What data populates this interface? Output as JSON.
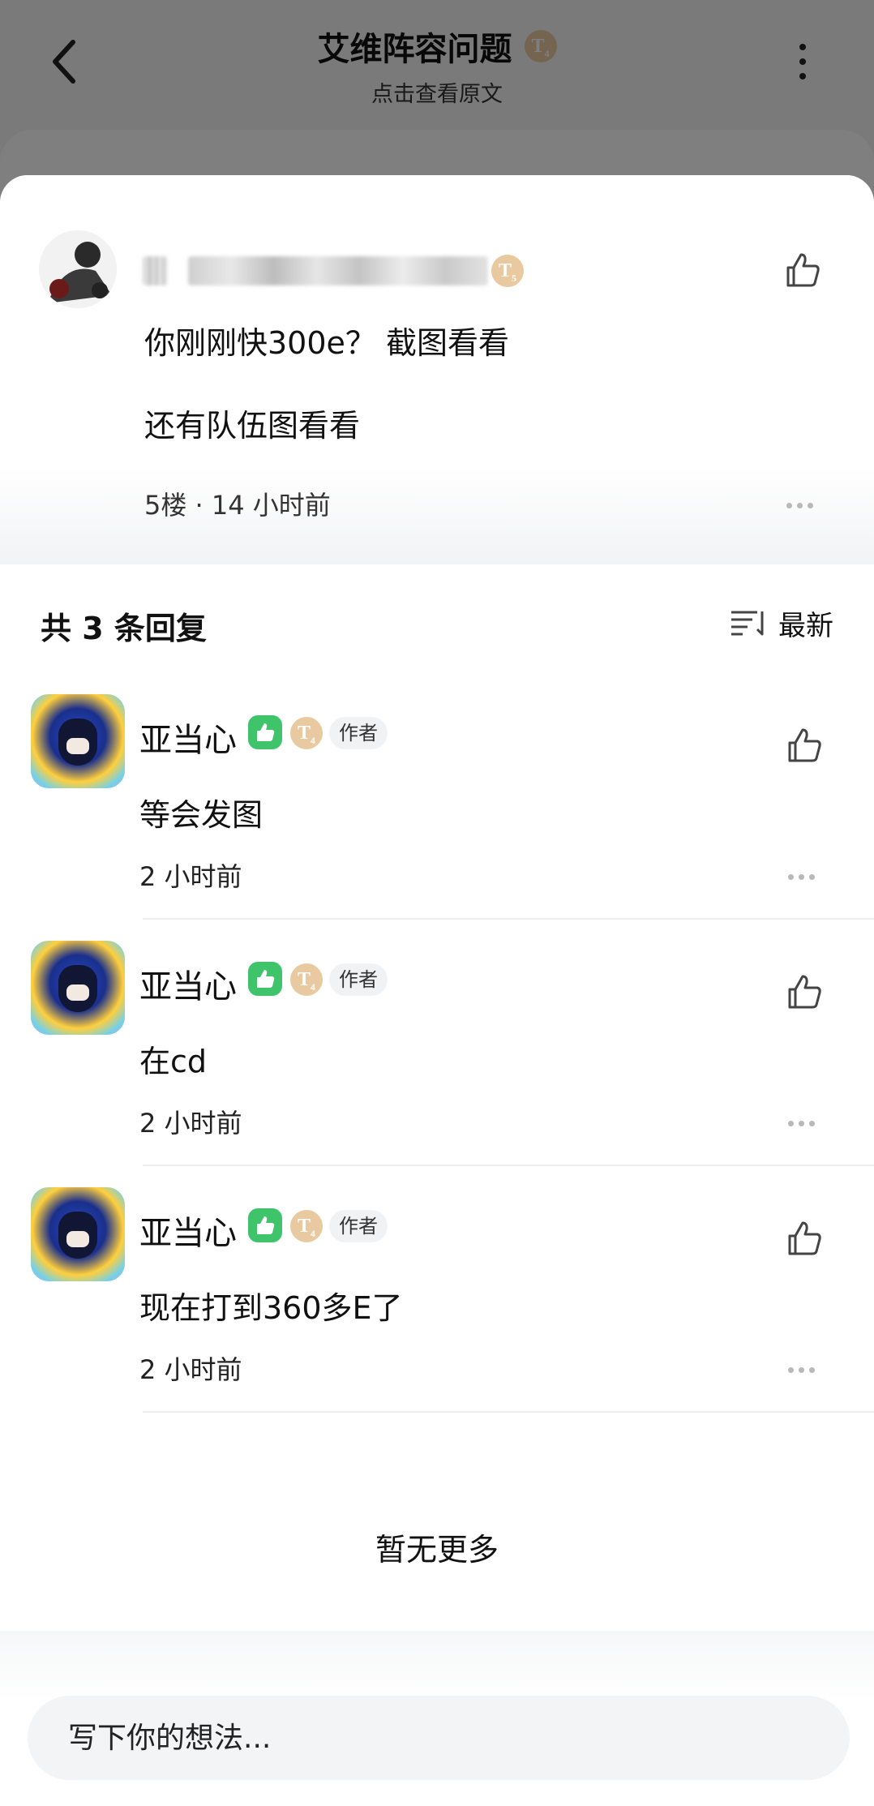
{
  "page": {
    "title": "艾维阵容问题",
    "title_level": "T",
    "title_level_num": "4",
    "subtitle": "点击查看原文"
  },
  "comment": {
    "level": "T",
    "level_num": "5",
    "text_line1": "你刚刚快300e？ 截图看看",
    "text_line2": "还有队伍图看看",
    "meta": "5楼 · 14 小时前"
  },
  "replies_section": {
    "count_label": "共 3 条回复",
    "sort_label": "最新"
  },
  "replies": [
    {
      "name": "亚当心",
      "level": "T",
      "level_num": "4",
      "tag": "作者",
      "text": "等会发图",
      "time": "2 小时前"
    },
    {
      "name": "亚当心",
      "level": "T",
      "level_num": "4",
      "tag": "作者",
      "text": "在cd",
      "time": "2 小时前"
    },
    {
      "name": "亚当心",
      "level": "T",
      "level_num": "4",
      "tag": "作者",
      "text": "现在打到360多E了",
      "time": "2 小时前"
    }
  ],
  "end_text": "暂无更多",
  "input": {
    "placeholder": "写下你的想法..."
  },
  "colors": {
    "level_badge": "#e9c9a0",
    "green_badge": "#3fc46b",
    "overlay": "rgba(0,0,0,0.5)"
  },
  "icons": [
    "back-icon",
    "more-vertical-icon",
    "like-icon",
    "more-horizontal-icon",
    "sort-icon",
    "thumbs-up-badge-icon"
  ]
}
